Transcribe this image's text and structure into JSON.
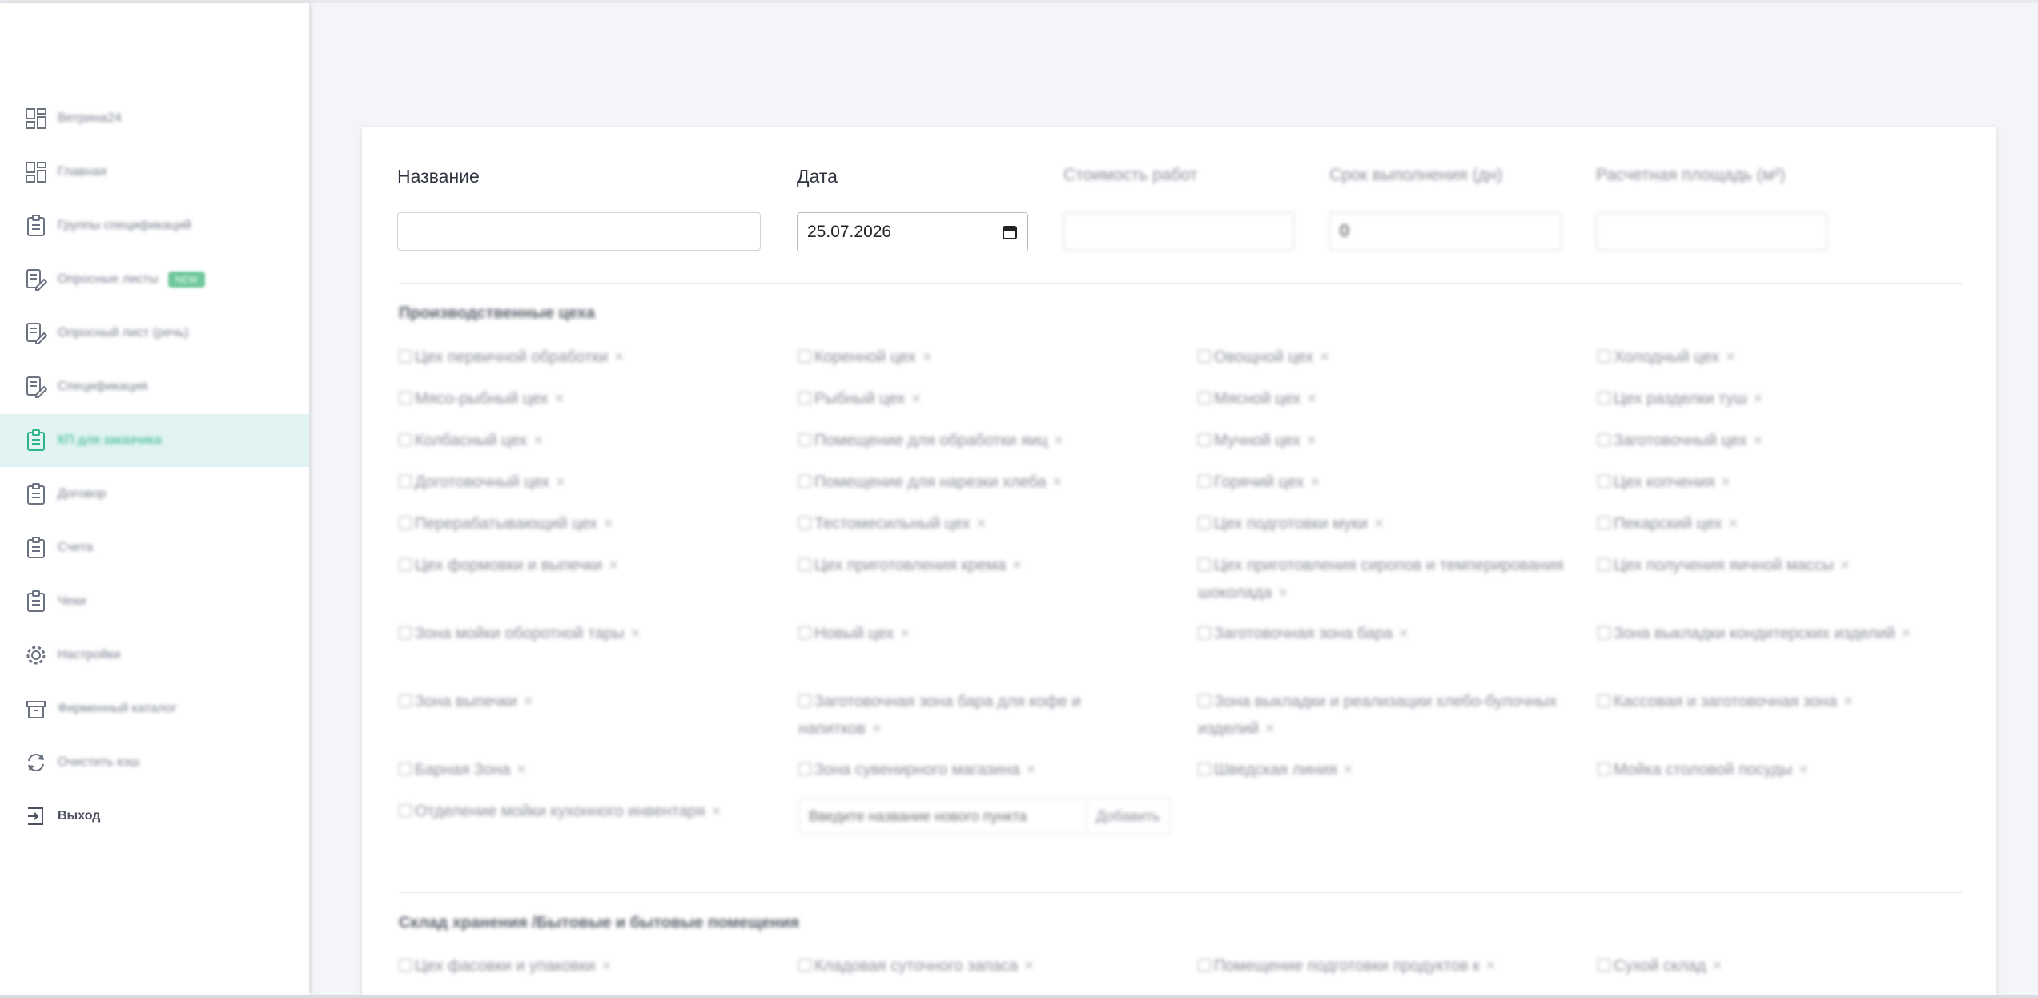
{
  "sidebar": {
    "items": [
      {
        "label": "Ветрина24",
        "icon": "dashboard-icon"
      },
      {
        "label": "Главная",
        "icon": "dashboard-icon"
      },
      {
        "label": "Группы спецификаций",
        "icon": "clipboard-icon"
      },
      {
        "label": "Опросные листы",
        "icon": "document-edit-icon",
        "badge": "NEW"
      },
      {
        "label": "Опросный лист (речь)",
        "icon": "document-edit-icon"
      },
      {
        "label": "Спецификация",
        "icon": "document-edit-icon"
      },
      {
        "label": "КП для заказчика",
        "icon": "clipboard-icon",
        "active": true
      },
      {
        "label": "Договор",
        "icon": "clipboard-icon"
      },
      {
        "label": "Счета",
        "icon": "clipboard-icon"
      },
      {
        "label": "Чеки",
        "icon": "clipboard-icon"
      },
      {
        "label": "Настройки",
        "icon": "gear-icon"
      },
      {
        "label": "Фирменный каталог",
        "icon": "archive-icon"
      },
      {
        "label": "Очистить кэш",
        "icon": "refresh-icon"
      },
      {
        "label": "Выход",
        "icon": "logout-icon"
      }
    ]
  },
  "form": {
    "name_label": "Название",
    "name_value": "",
    "date_label": "Дата",
    "date_value": "25.07.2026",
    "cost_label": "Стоимость работ",
    "term_label": "Срок выполнения (дн)",
    "term_value": "0",
    "area_label": "Расчетная площадь (м²)"
  },
  "sections": [
    {
      "title": "Производственные цеха",
      "items": [
        "Цех первичной обработки",
        "Коренной цех",
        "Овощной цех",
        "Холодный цех",
        "Мясо-рыбный цех",
        "Рыбный цех",
        "Мясной цех",
        "Цех разделки туш",
        "Колбасный цех",
        "Помещение для обработки яиц",
        "Мучной цех",
        "Заготовочный цех",
        "Доготовочный цех",
        "Помещение для нарезки хлеба",
        "Горячий цех",
        "Цех копчения",
        "Перерабатывающий цех",
        "Тестомесильный цех",
        "Цех подготовки муки",
        "Пекарский цех",
        "Цех формовки и выпечки",
        "Цех приготовления крема",
        "Цех приготовления сиропов и темперирования шоколада",
        "Цех получения яичной массы",
        "Зона мойки оборотной тары",
        "Новый цех",
        "Заготовочная зона бара",
        "Зона выкладки кондитерских изделий",
        "Зона выпечки",
        "Заготовочная зона бара для кофе и напитков",
        "Зона выкладки и реализации хлебо-булочных изделий",
        "Кассовая и заготовочная зона",
        "Барная Зона",
        "Зона сувенирного магазина",
        "Шведская линия",
        "Мойка столовой посуды",
        "Отделение мойки кухонного инвентаря"
      ],
      "add_placeholder": "Введите название нового пункта",
      "add_button": "Добавить"
    },
    {
      "title": "Склад хранения /Бытовые и бытовые помещения",
      "items": [
        "Цех фасовки и упаковки",
        "Кладовая суточного запаса",
        "Помещение подготовки продуктов к",
        "Сухой склад"
      ]
    }
  ]
}
